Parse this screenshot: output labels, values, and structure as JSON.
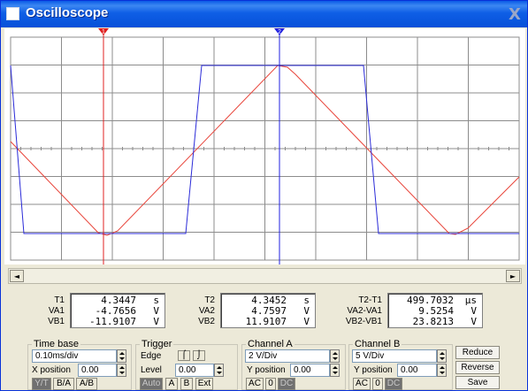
{
  "window": {
    "title": "Oscilloscope",
    "close_glyph": "X"
  },
  "scope": {
    "background": "#ffffff",
    "grid_color": "#8c8c8c",
    "channel_a_color": "#e8443a",
    "channel_b_color": "#2b2bd8",
    "cursor1_label": "1",
    "cursor2_label": "2"
  },
  "scrollbar": {
    "left_glyph": "◄",
    "right_glyph": "►"
  },
  "readouts": {
    "t1": {
      "labels": [
        "T1",
        "VA1",
        "VB1"
      ],
      "values": [
        "4.3447",
        "-4.7656",
        "-11.9107"
      ],
      "units": [
        "s",
        "V",
        "V"
      ]
    },
    "t2": {
      "labels": [
        "T2",
        "VA2",
        "VB2"
      ],
      "values": [
        "4.3452",
        "4.7597",
        "11.9107"
      ],
      "units": [
        "s",
        "V",
        "V"
      ]
    },
    "diff": {
      "labels": [
        "T2-T1",
        "VA2-VA1",
        "VB2-VB1"
      ],
      "values": [
        "499.7032",
        "9.5254",
        "23.8213"
      ],
      "units": [
        "µs",
        "V",
        "V"
      ]
    }
  },
  "timebase": {
    "legend": "Time base",
    "value": "0.10ms/div",
    "xpos_label": "X position",
    "xpos_value": "0.00",
    "modes": [
      "Y/T",
      "B/A",
      "A/B"
    ]
  },
  "trigger": {
    "legend": "Trigger",
    "edge_label": "Edge",
    "level_label": "Level",
    "level_value": "0.00",
    "sources": [
      "Auto",
      "A",
      "B",
      "Ext"
    ]
  },
  "channel_a": {
    "legend": "Channel A",
    "value": "2 V/Div",
    "ypos_label": "Y position",
    "ypos_value": "0.00",
    "coupling": [
      "AC",
      "0",
      "DC"
    ]
  },
  "channel_b": {
    "legend": "Channel B",
    "value": "5 V/Div",
    "ypos_label": "Y position",
    "ypos_value": "0.00",
    "coupling": [
      "AC",
      "0",
      "DC"
    ]
  },
  "actions": {
    "reduce": "Reduce",
    "reverse": "Reverse",
    "save": "Save"
  }
}
